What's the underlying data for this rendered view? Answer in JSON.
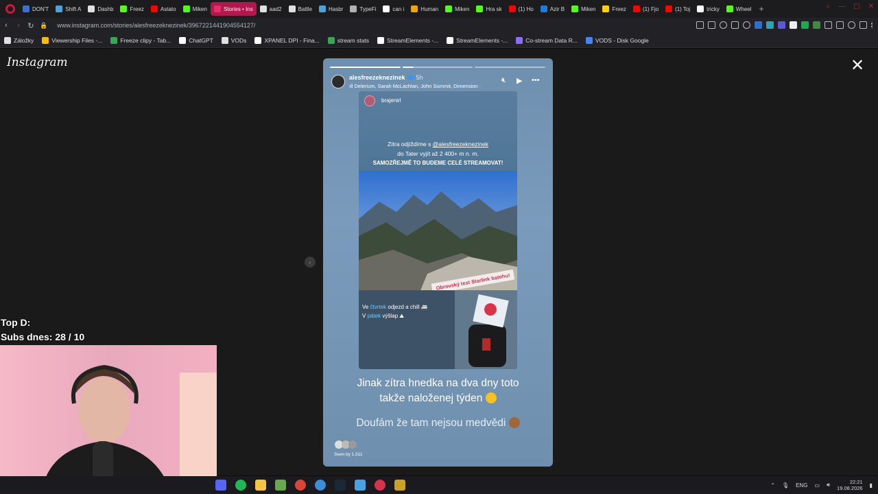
{
  "browser": {
    "tabs": [
      {
        "label": "DON'T",
        "color": "#3b6fd8"
      },
      {
        "label": "Shift A",
        "color": "#4aa3df"
      },
      {
        "label": "Dashb",
        "color": "#e0e0e0"
      },
      {
        "label": "Freez",
        "color": "#53fc18"
      },
      {
        "label": "Astato",
        "color": "#ff0000"
      },
      {
        "label": "Miken",
        "color": "#53fc18"
      },
      {
        "label": "Stories • Ins",
        "color": "#e1306c",
        "active": true
      },
      {
        "label": "aad2",
        "color": "#e0e0e0"
      },
      {
        "label": "Battle",
        "color": "#e0e0e0"
      },
      {
        "label": "Hasbr",
        "color": "#4aa3df"
      },
      {
        "label": "TypeFi",
        "color": "#b0b0b0"
      },
      {
        "label": "can i",
        "color": "#ffffff"
      },
      {
        "label": "Human",
        "color": "#f4a300"
      },
      {
        "label": "Miken",
        "color": "#53fc18"
      },
      {
        "label": "Hra sk",
        "color": "#53fc18"
      },
      {
        "label": "(1) Ho",
        "color": "#ff0000"
      },
      {
        "label": "Azir B",
        "color": "#1f7ad8"
      },
      {
        "label": "Miken",
        "color": "#53fc18"
      },
      {
        "label": "Freez",
        "color": "#ffd000"
      },
      {
        "label": "(1) Fjo",
        "color": "#ff0000"
      },
      {
        "label": "(1) Toj",
        "color": "#ff0000"
      },
      {
        "label": "tricky",
        "color": "#ffffff"
      },
      {
        "label": "Wheel",
        "color": "#53fc18"
      }
    ],
    "new_tab": "+",
    "url": "www.instagram.com/stories/alesfreezeknezinek/3967221441904554127/",
    "bookmarks": [
      {
        "label": "Záložky",
        "color": "#e0e0e0"
      },
      {
        "label": "Viewership Files -...",
        "color": "#fbbc04"
      },
      {
        "label": "Freeze clipy - Tab...",
        "color": "#34a853"
      },
      {
        "label": "ChatGPT",
        "color": "#ffffff"
      },
      {
        "label": "VODs",
        "color": "#e0e0e0"
      },
      {
        "label": "XPANEL DPI - Fina...",
        "color": "#ffffff"
      },
      {
        "label": "stream stats",
        "color": "#34a853"
      },
      {
        "label": "StreamElements -...",
        "color": "#ffffff"
      },
      {
        "label": "StreamElements -...",
        "color": "#ffffff"
      },
      {
        "label": "Co-stream Data R...",
        "color": "#8a6cff"
      },
      {
        "label": "VODS - Disk Google",
        "color": "#4285f4"
      }
    ]
  },
  "instagram": {
    "logo": "Instagram",
    "story": {
      "username": "alesfreezeknezinek",
      "time": "5h",
      "music": "Delerium, Sarah McLachlan, John Summit, Dimension ·",
      "progress_segments": 3,
      "repost": {
        "username": "brajenirl",
        "line1_prefix": "Zítra odjíždíme s ",
        "mention": "@alesfreezeknezinek",
        "line2": "do Tater vyjít až 2 400+ m n. m.",
        "line3": "SAMOZŘEJMĚ TO BUDEME CELÉ STREAMOVAT!",
        "sticker": "Obrovský test Starlink batohu!",
        "line4_prefix": "Ve ",
        "line4_link": "čtvrtek",
        "line4_suffix": " odjezd a chill",
        "line5_prefix": "V ",
        "line5_link": "pátek",
        "line5_suffix": " výšlap"
      },
      "caption1_line1": "Jinak zítra hnedka na dva dny toto",
      "caption1_line2": "takže naloženej týden",
      "caption2": "Doufám že tam nejsou medvědi",
      "seen_by": "Seen by 1,511"
    }
  },
  "overlay": {
    "top_d": "Top D:",
    "subs": "Subs dnes: 28 / 10"
  },
  "taskbar": {
    "lang": "ENG",
    "time": "22:21",
    "date": "19.08.2026"
  }
}
